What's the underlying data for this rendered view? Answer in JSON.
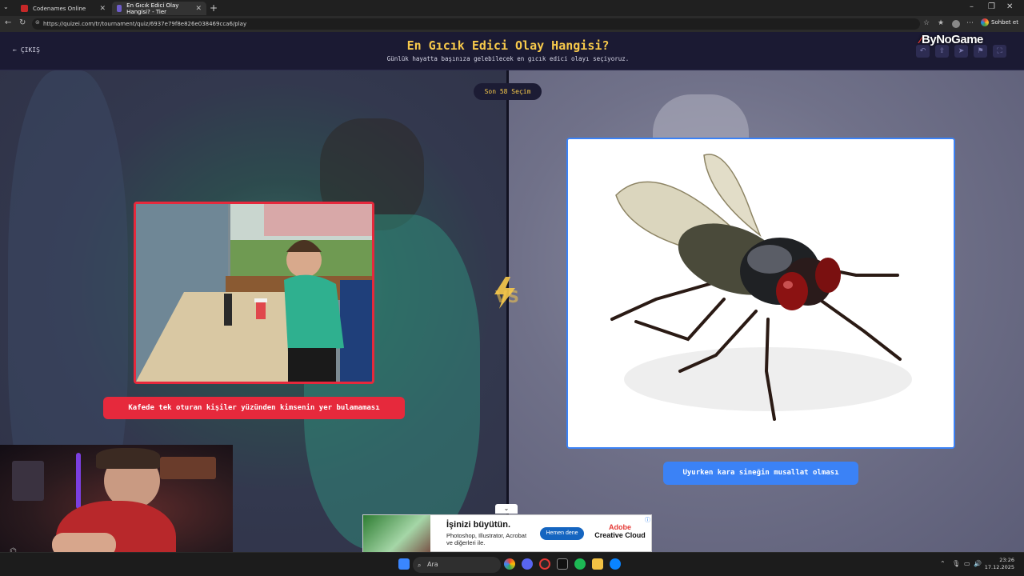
{
  "browser": {
    "tabs": [
      {
        "title": "Codenames Online",
        "active": false
      },
      {
        "title": "En Gıcık Edici Olay Hangisi? - Tier",
        "active": true
      }
    ],
    "url": "https://quizei.com/tr/tournament/quiz/6937e79f8e826e038469cca6/play",
    "profile_button": "Sohbet et"
  },
  "page": {
    "exit_label": "ÇIKIŞ",
    "title": "En Gıcık Edici Olay Hangisi?",
    "subtitle": "Günlük hayatta başınıza gelebilecek en gıcık edici olayı seçiyoruz.",
    "brand": "ByNoGame",
    "round_label": "Son 58 Seçim",
    "vs_label": "VS",
    "left_option": {
      "label": "Kafede tek oturan kişiler yüzünden kimsenin yer bulamaması",
      "accent": "#e6293c"
    },
    "right_option": {
      "label": "Uyurken kara sineğin musallat olması",
      "accent": "#3b82f6"
    },
    "accent_yellow": "#f7c94b"
  },
  "ad": {
    "headline": "İşinizi büyütün.",
    "body": "Photoshop, Illustrator, Acrobat ve diğerleri ile.",
    "cta": "Hemen dene",
    "brand_line1": "Adobe",
    "brand_line2": "Creative Cloud"
  },
  "taskbar": {
    "search_placeholder": "Ara",
    "time": "23:26",
    "date": "17.12.2025"
  }
}
